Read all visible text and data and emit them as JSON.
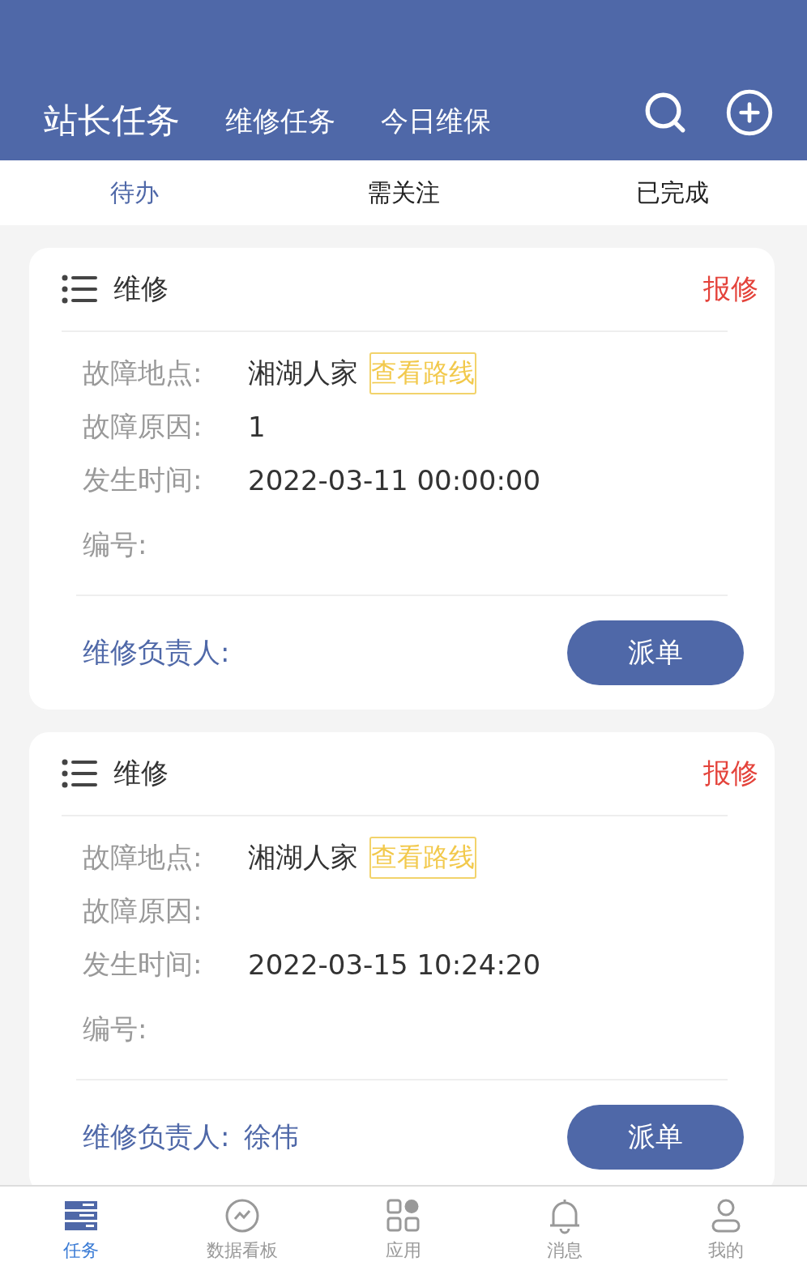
{
  "header": {
    "tabs": [
      {
        "label": "站长任务",
        "selected": true
      },
      {
        "label": "维修任务",
        "selected": false
      },
      {
        "label": "今日维保",
        "selected": false
      }
    ]
  },
  "subtabs": [
    {
      "label": "待办",
      "selected": true
    },
    {
      "label": "需关注",
      "selected": false
    },
    {
      "label": "已完成",
      "selected": false
    }
  ],
  "cards": [
    {
      "title": "维修",
      "status": "报修",
      "fields": [
        {
          "label": "故障地点:",
          "value": "湘湖人家",
          "link": "查看路线"
        },
        {
          "label": "故障原因:",
          "value": "1"
        },
        {
          "label": "发生时间:",
          "value": "2022-03-11 00:00:00"
        },
        {
          "label": "编号:"
        }
      ],
      "owner_label": "维修负责人:",
      "button": "派单"
    },
    {
      "title": "维修",
      "status": "报修",
      "fields": [
        {
          "label": "故障地点:",
          "value": "湘湖人家",
          "link": "查看路线"
        },
        {
          "label": "故障原因:"
        },
        {
          "label": "发生时间:",
          "value": "2022-03-15 10:24:20"
        },
        {
          "label": "编号:"
        }
      ],
      "owner_label": "维修负责人:",
      "owner": "徐伟",
      "button": "派单"
    }
  ],
  "bottom_nav": [
    {
      "kind": "tasks",
      "label": "任务",
      "selected": true
    },
    {
      "kind": "dashboard",
      "label": "数据看板",
      "selected": false
    },
    {
      "kind": "apps",
      "label": "应用",
      "selected": false
    },
    {
      "kind": "messages",
      "label": "消息",
      "selected": false
    },
    {
      "kind": "profile",
      "label": "我的",
      "selected": false
    }
  ]
}
